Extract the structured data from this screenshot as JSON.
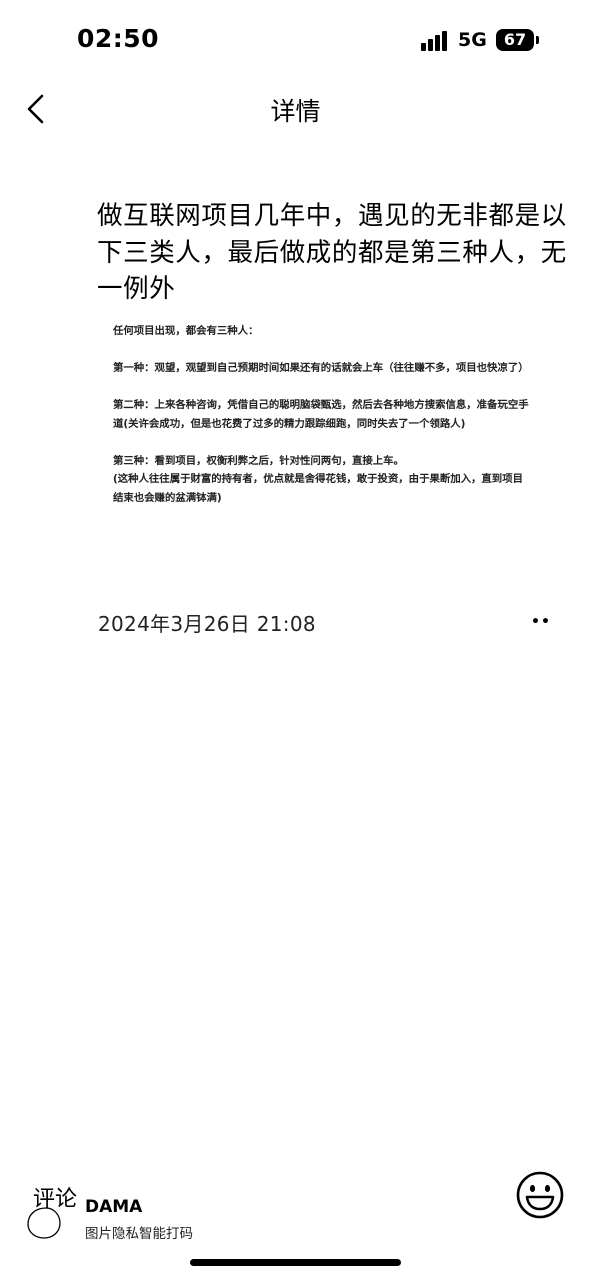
{
  "status_bar": {
    "time": "02:50",
    "network": "5G",
    "battery": "67"
  },
  "nav": {
    "title": "详情",
    "back_icon": "chevron-left-icon"
  },
  "article": {
    "title": "做互联网项目几年中，遇见的无非都是以下三类人，最后做成的都是第三种人，无一例外",
    "body": {
      "intro": "任何项目出现，都会有三种人：",
      "type1": "第一种：观望，观望到自己预期时间如果还有的话就会上车（往往赚不多，项目也快凉了）",
      "type2": "第二种：上来各种咨询，凭借自己的聪明脑袋甄选，然后去各种地方搜索信息，准备玩空手道(关许会成功，但是也花费了过多的精力跟踪细跑，同时失去了一个领路人)",
      "type3_a": "第三种：看到项目，权衡利弊之后，针对性问两句，直接上车。",
      "type3_b": "(这种人往往属于财富的持有者，优点就是舍得花钱，敢于投资，由于果断加入，直到项目结束也会赚的盆满钵满)"
    },
    "date": "2024年3月26日 21:08",
    "more_label": "••"
  },
  "bottom": {
    "comment_label": "评论",
    "watermark_name": "DAMA",
    "watermark_tag": "图片隐私智能打码",
    "emoji_icon": "smiley-icon"
  }
}
